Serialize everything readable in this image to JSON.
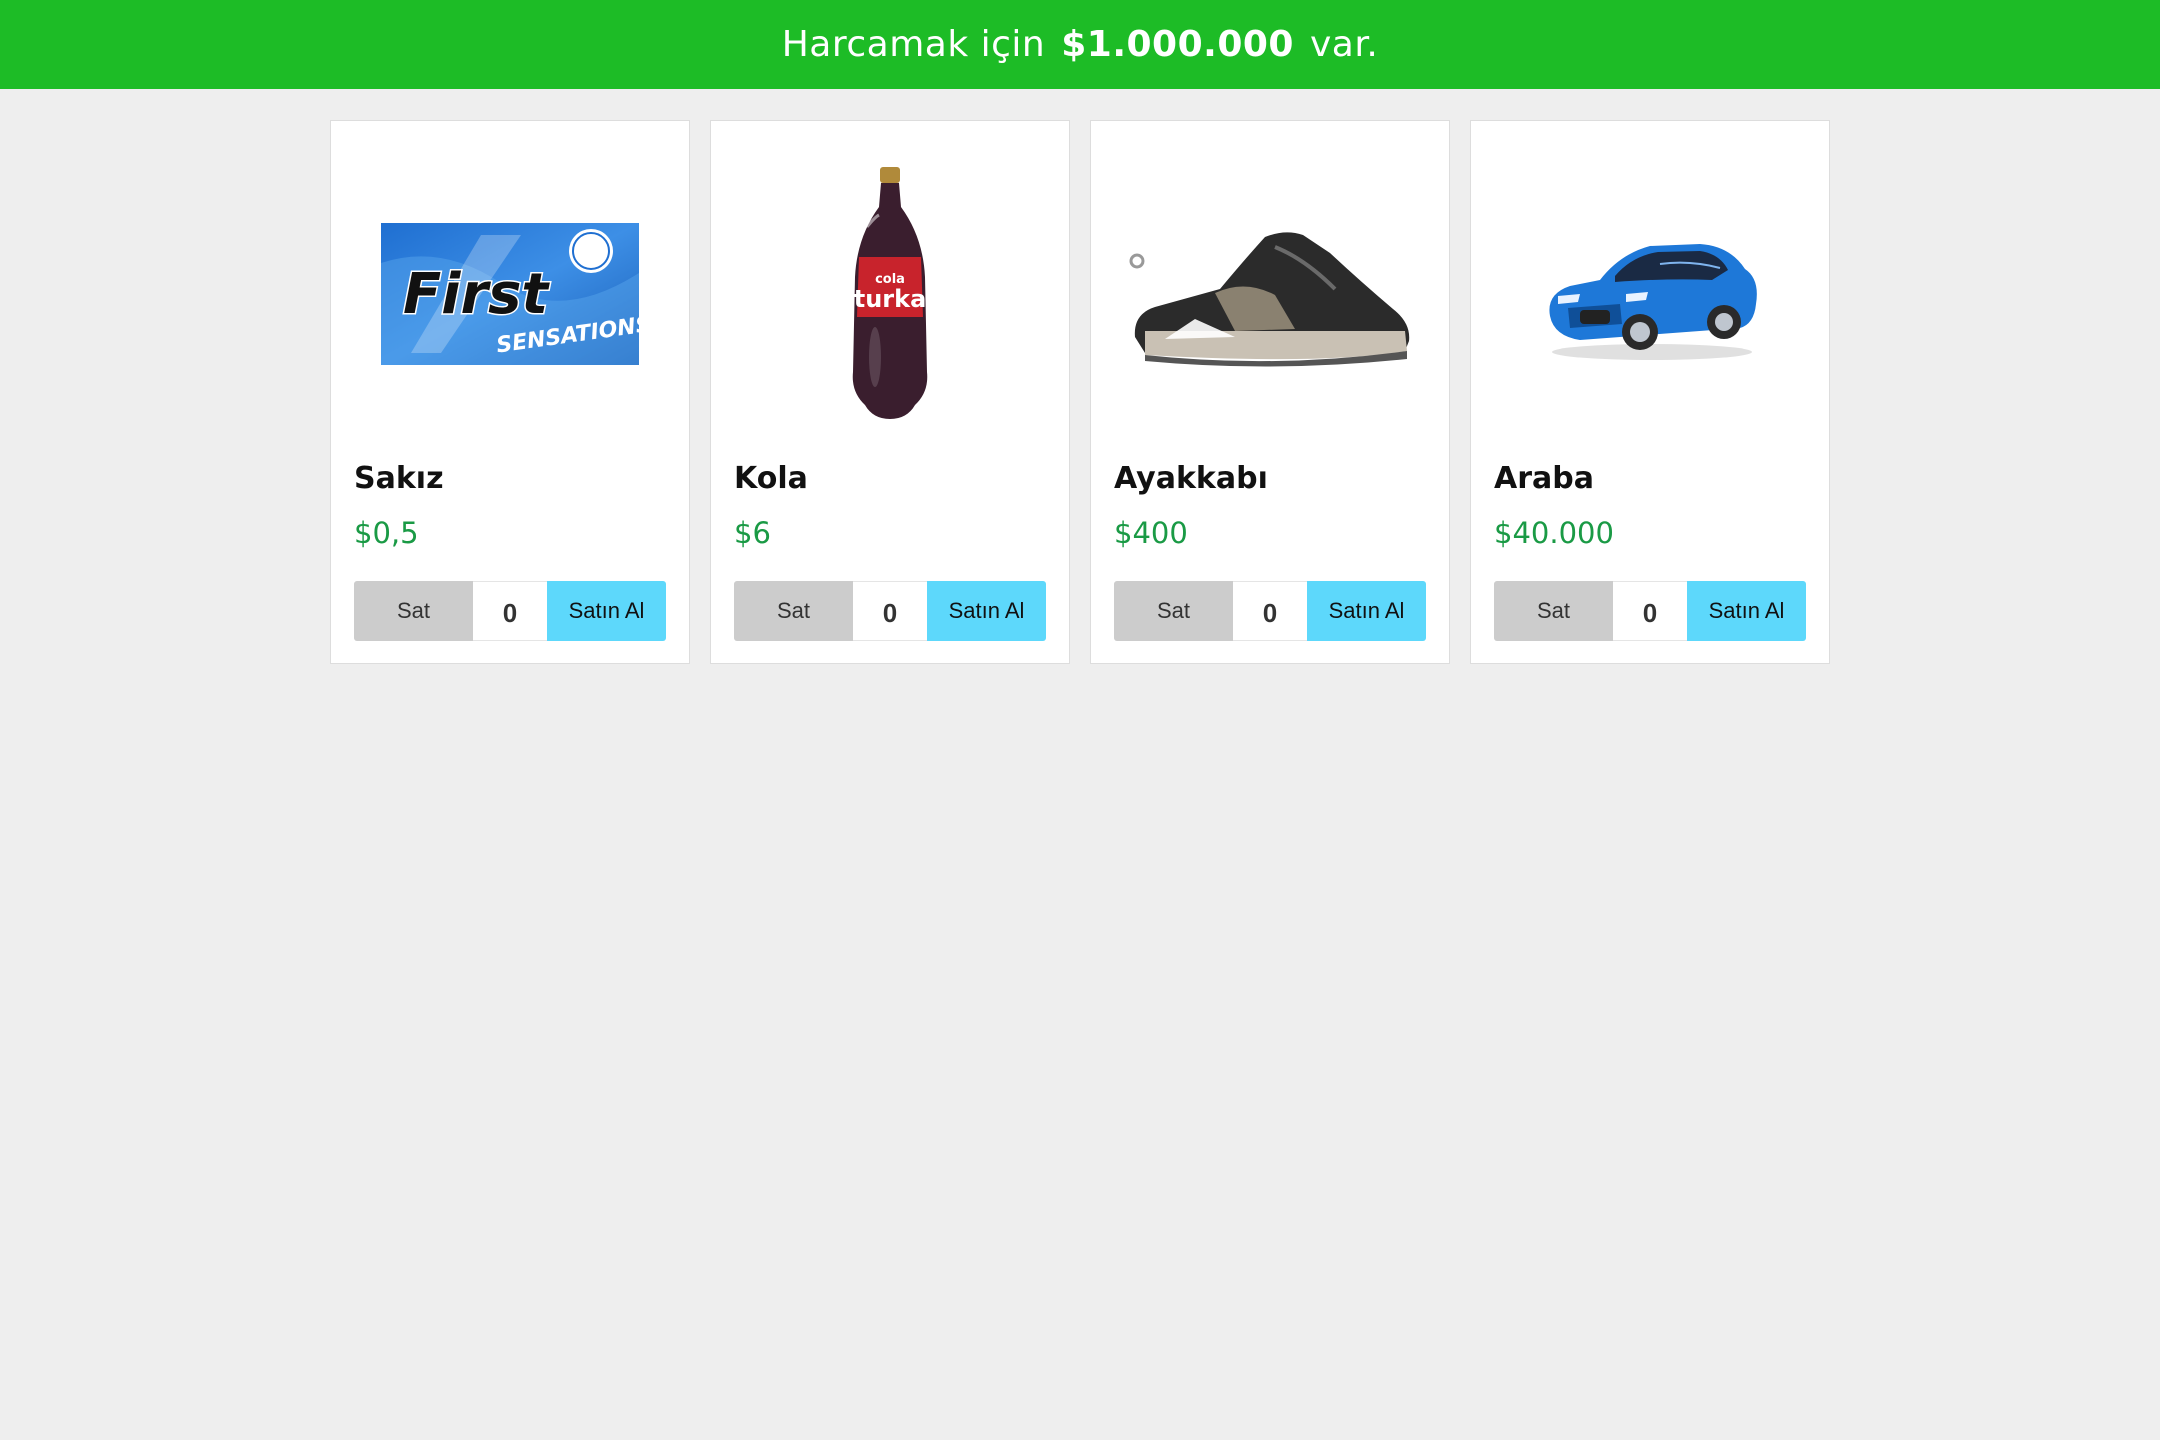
{
  "header": {
    "prefix": "Harcamak için",
    "amount": "$1.000.000",
    "suffix": "var.",
    "bg_color": "#1dbc26"
  },
  "products": [
    {
      "name": "Sakız",
      "price": "$0,5",
      "qty": "0",
      "sell_label": "Sat",
      "buy_label": "Satın Al",
      "image": "gum-pack-image"
    },
    {
      "name": "Kola",
      "price": "$6",
      "qty": "0",
      "sell_label": "Sat",
      "buy_label": "Satın Al",
      "image": "cola-bottle-image"
    },
    {
      "name": "Ayakkabı",
      "price": "$400",
      "qty": "0",
      "sell_label": "Sat",
      "buy_label": "Satın Al",
      "image": "shoe-image"
    },
    {
      "name": "Araba",
      "price": "$40.000",
      "qty": "0",
      "sell_label": "Sat",
      "buy_label": "Satın Al",
      "image": "car-image"
    }
  ],
  "colors": {
    "price": "#1a9a45",
    "sell_button": "#cccccc",
    "buy_button": "#5dd8fb",
    "background": "#eeeeee"
  }
}
